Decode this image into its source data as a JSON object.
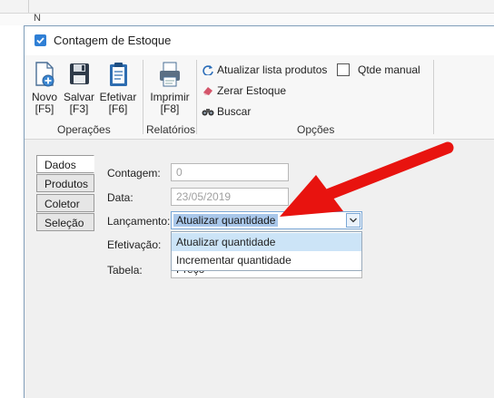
{
  "background": {
    "header_fragment": "N"
  },
  "window": {
    "title": "Contagem de Estoque"
  },
  "toolbar": {
    "operations": [
      {
        "label": "Novo",
        "shortcut": "[F5]",
        "icon": "new-document-icon"
      },
      {
        "label": "Salvar",
        "shortcut": "[F3]",
        "icon": "save-disk-icon"
      },
      {
        "label": "Efetivar",
        "shortcut": "[F6]",
        "icon": "clipboard-icon"
      }
    ],
    "reports": [
      {
        "label": "Imprimir",
        "shortcut": "[F8]",
        "icon": "printer-icon"
      }
    ],
    "options": {
      "refresh_products": "Atualizar lista produtos",
      "manual_qty": "Qtde manual",
      "reset_stock": "Zerar Estoque",
      "search": "Buscar"
    },
    "groups": {
      "operations": "Operações",
      "reports": "Relatórios",
      "options": "Opções"
    }
  },
  "tabs": [
    "Dados",
    "Produtos",
    "Coletor",
    "Seleção"
  ],
  "form": {
    "contagem_label": "Contagem:",
    "contagem_value": "0",
    "data_label": "Data:",
    "data_value": "23/05/2019",
    "lancamento_label": "Lançamento:",
    "lancamento_value": "Atualizar quantidade",
    "efetivacao_label": "Efetivação:",
    "tabela_label": "Tabela:",
    "tabela_value_partial": "Preço"
  },
  "dropdown": {
    "options": [
      "Atualizar quantidade",
      "Incrementar quantidade"
    ],
    "highlighted_index": 0
  },
  "colors": {
    "accent": "#2f7fd5",
    "arrow": "#e8130f",
    "highlight": "#cce4f7",
    "selection": "#a9c7ea"
  }
}
